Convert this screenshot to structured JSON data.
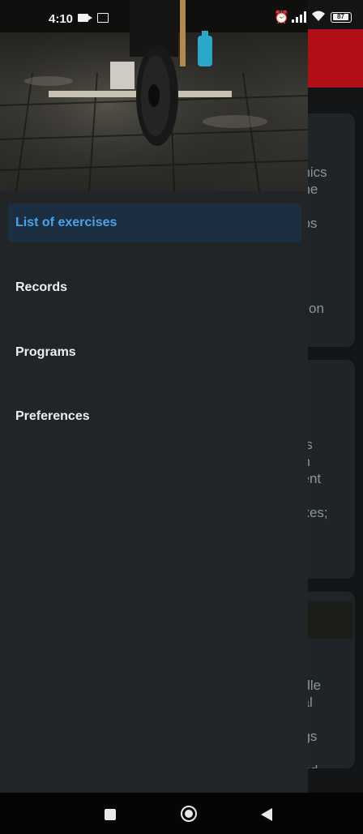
{
  "status_bar": {
    "time": "4:10",
    "battery_level": "87",
    "icons": [
      "video-icon",
      "sim-icon",
      "alarm-off-icon",
      "signal-icon",
      "wifi-icon",
      "battery-icon"
    ]
  },
  "drawer": {
    "menu": [
      {
        "label": "List of exercises",
        "active": true
      },
      {
        "label": "Records",
        "active": false
      },
      {
        "label": "Programs",
        "active": false
      },
      {
        "label": "Preferences",
        "active": false
      }
    ]
  },
  "background_cards": [
    {
      "text": "enics\none\ng\nups\n\n\nt\n,\nction"
    },
    {
      "text": "\n\n\nn\nips\nen\ncent\nts\nexes;\n\n\n."
    },
    {
      "text": "\n\n\n\nn\nddle\ncal\n\negs\ng\nand"
    }
  ],
  "colors": {
    "accent": "#4aa3e8",
    "active_item_bg": "#1b2f41",
    "drawer_bg": "#222527",
    "toolbar_red": "#b01015"
  },
  "nav_bar": {
    "buttons": [
      "recents-icon",
      "home-icon",
      "back-icon"
    ]
  }
}
